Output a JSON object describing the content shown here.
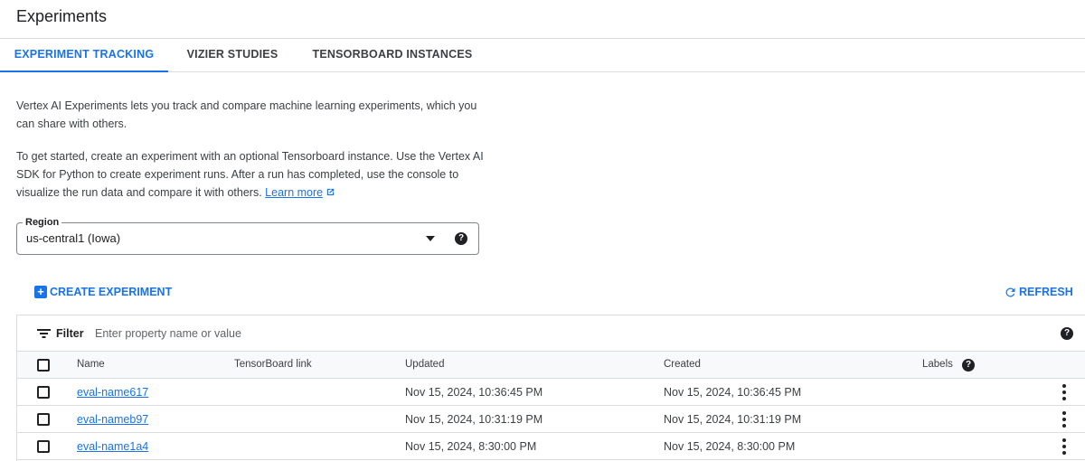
{
  "page": {
    "title": "Experiments"
  },
  "tabs": [
    {
      "label": "EXPERIMENT TRACKING",
      "active": true
    },
    {
      "label": "VIZIER STUDIES",
      "active": false
    },
    {
      "label": "TENSORBOARD INSTANCES",
      "active": false
    }
  ],
  "description": {
    "para1": "Vertex AI Experiments lets you track and compare machine learning experiments, which you can share with others.",
    "para2": "To get started, create an experiment with an optional Tensorboard instance. Use the Vertex AI SDK for Python to create experiment runs. After a run has completed, use the console to visualize the run data and compare it with others.",
    "learn_more": "Learn more"
  },
  "region": {
    "label": "Region",
    "value": "us-central1 (Iowa)"
  },
  "actions": {
    "create_label": "CREATE EXPERIMENT",
    "refresh_label": "REFRESH"
  },
  "filter": {
    "label": "Filter",
    "placeholder": "Enter property name or value"
  },
  "table": {
    "columns": [
      "Name",
      "TensorBoard link",
      "Updated",
      "Created",
      "Labels"
    ],
    "rows": [
      {
        "name": "eval-name617",
        "tensorboard": "",
        "updated": "Nov 15, 2024, 10:36:45 PM",
        "created": "Nov 15, 2024, 10:36:45 PM",
        "labels": ""
      },
      {
        "name": "eval-nameb97",
        "tensorboard": "",
        "updated": "Nov 15, 2024, 10:31:19 PM",
        "created": "Nov 15, 2024, 10:31:19 PM",
        "labels": ""
      },
      {
        "name": "eval-name1a4",
        "tensorboard": "",
        "updated": "Nov 15, 2024, 8:30:00 PM",
        "created": "Nov 15, 2024, 8:30:00 PM",
        "labels": ""
      }
    ]
  },
  "icons": {
    "help": "help-circle-icon",
    "external": "external-link-icon",
    "dropdown": "dropdown-arrow-icon",
    "create": "add-box-icon",
    "refresh": "refresh-icon",
    "filter": "filter-list-icon",
    "more": "more-vert-icon"
  },
  "colors": {
    "accent": "#1a73e8",
    "text": "#202124",
    "border": "#dadce0",
    "header_bg": "#f8f9fa"
  }
}
